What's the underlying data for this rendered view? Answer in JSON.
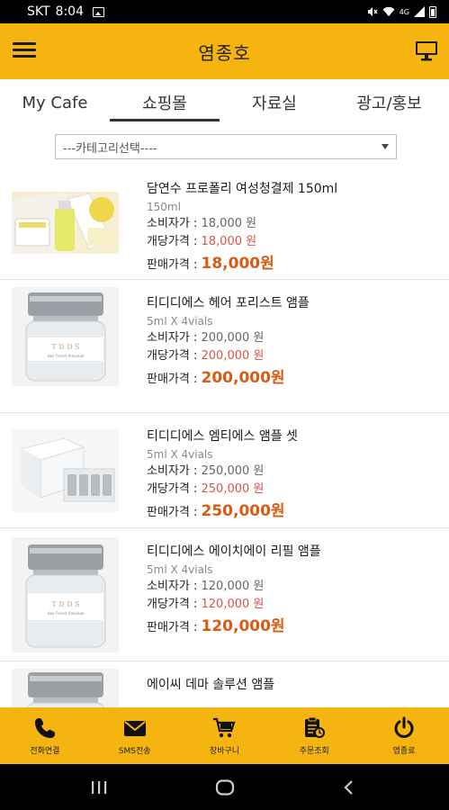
{
  "status_bar": {
    "carrier": "SKT",
    "time": "8:04",
    "signal_text": "4G"
  },
  "header": {
    "title": "염종호"
  },
  "tabs": [
    {
      "label": "My Cafe"
    },
    {
      "label": "쇼핑몰"
    },
    {
      "label": "자료실"
    },
    {
      "label": "광고/홍보"
    }
  ],
  "category_select": {
    "selected": "---카테고리선택----"
  },
  "labels": {
    "consumer_price": "소비자가 : ",
    "dealer_price": "개당가격 : ",
    "sale_price": "판매가격 : "
  },
  "products": [
    {
      "name": "담연수 프로폴리 여성청결제 150ml",
      "spec": "150ml",
      "consumer_price": "18,000 원",
      "dealer_price": "18,000 원",
      "sale_price": "18,000원"
    },
    {
      "name": "티디디에스 헤어 포리스트 앰플",
      "spec": "5ml X 4vials",
      "consumer_price": "200,000 원",
      "dealer_price": "200,000 원",
      "sale_price": "200,000원"
    },
    {
      "name": "티디디에스 엠티에스 앰플 셋",
      "spec": "5ml X 4vials",
      "consumer_price": "250,000 원",
      "dealer_price": "250,000 원",
      "sale_price": "250,000원"
    },
    {
      "name": "티디디에스 에이치에이 리필 앰플",
      "spec": "5ml X 4vials",
      "consumer_price": "120,000 원",
      "dealer_price": "120,000 원",
      "sale_price": "120,000원"
    },
    {
      "name": "에이씨 데마 솔루션 앰플",
      "spec": "",
      "consumer_price": "",
      "dealer_price": "",
      "sale_price": ""
    }
  ],
  "bottom_nav": [
    {
      "label": "전화연결",
      "icon": "phone-icon"
    },
    {
      "label": "SMS전송",
      "icon": "envelope-icon"
    },
    {
      "label": "장바구니",
      "icon": "cart-icon"
    },
    {
      "label": "주문조회",
      "icon": "order-icon"
    },
    {
      "label": "앱종료",
      "icon": "power-icon"
    }
  ],
  "colors": {
    "accent": "#f5b40f",
    "sale_price": "#d95b12",
    "dealer_price": "#d9534f"
  }
}
